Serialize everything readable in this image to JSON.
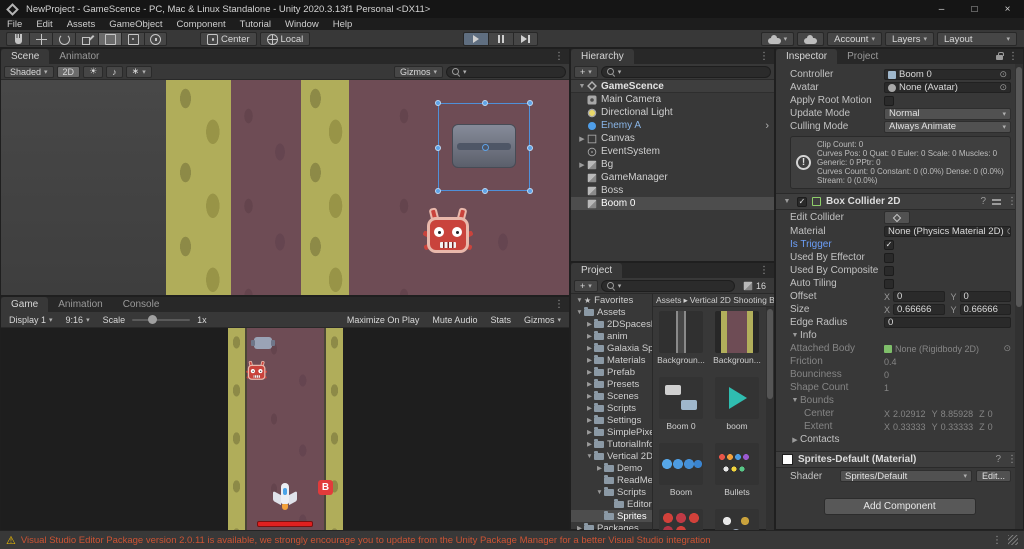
{
  "icons": {
    "caret": "▾",
    "fold_open": "▼",
    "fold_closed": "▶",
    "menu": "⋮",
    "star": "★",
    "warning": "⚠",
    "check": "✓",
    "chevron": "›",
    "crumb_sep": "▸",
    "picker": "⊙",
    "note": "♪",
    "sun": "☀",
    "fx": "∗",
    "plus": "+",
    "question": "?"
  },
  "titlebar": {
    "title": "NewProject - GameScence - PC, Mac & Linux Standalone - Unity 2020.3.13f1 Personal <DX11>",
    "minimize": "–",
    "maximize": "□",
    "close": "×"
  },
  "menubar": {
    "items": [
      "File",
      "Edit",
      "Assets",
      "GameObject",
      "Component",
      "Tutorial",
      "Window",
      "Help"
    ]
  },
  "toolbar": {
    "center": "Center",
    "local": "Local",
    "account": "Account",
    "layers": "Layers",
    "layout": "Layout"
  },
  "scene": {
    "tab_scene": "Scene",
    "tab_animator": "Animator",
    "shaded": "Shaded",
    "mode_2d": "2D",
    "gizmos": "Gizmos"
  },
  "game": {
    "tab_game": "Game",
    "tab_animation": "Animation",
    "tab_console": "Console",
    "display": "Display 1",
    "aspect": "9:16",
    "scale_label": "Scale",
    "scale_value": "1x",
    "maximize_on_play": "Maximize On Play",
    "mute_audio": "Mute Audio",
    "stats": "Stats",
    "gizmos": "Gizmos",
    "boss_badge": "B"
  },
  "hierarchy": {
    "tab": "Hierarchy",
    "scene_name": "GameScence",
    "items": [
      {
        "label": "Main Camera"
      },
      {
        "label": "Directional Light"
      },
      {
        "label": "Enemy A"
      },
      {
        "label": "Canvas"
      },
      {
        "label": "EventSystem"
      },
      {
        "label": "Bg"
      },
      {
        "label": "GameManager"
      },
      {
        "label": "Boss"
      },
      {
        "label": "Boom 0"
      }
    ]
  },
  "project": {
    "tab": "Project",
    "hidden_count": "16",
    "tree": [
      {
        "label": "Favorites"
      },
      {
        "label": "Assets"
      },
      {
        "label": "2DSpacesh..."
      },
      {
        "label": "anim"
      },
      {
        "label": "Galaxia Spr..."
      },
      {
        "label": "Materials"
      },
      {
        "label": "Prefab"
      },
      {
        "label": "Presets"
      },
      {
        "label": "Scenes"
      },
      {
        "label": "Scripts"
      },
      {
        "label": "Settings"
      },
      {
        "label": "SimplePixel..."
      },
      {
        "label": "TutorialInfo"
      },
      {
        "label": "Vertical 2D ..."
      },
      {
        "label": "Demo"
      },
      {
        "label": "ReadMe"
      },
      {
        "label": "Scripts"
      },
      {
        "label": "Editor"
      },
      {
        "label": "Sprites"
      },
      {
        "label": "Packages"
      }
    ],
    "breadcrumb": {
      "root": "Assets",
      "current": "Vertical 2D Shooting B..."
    },
    "assets": [
      {
        "name": "Backgroun..."
      },
      {
        "name": "Backgroun..."
      },
      {
        "name": "Boom 0"
      },
      {
        "name": "boom"
      },
      {
        "name": "Boom"
      },
      {
        "name": "Bullets"
      }
    ]
  },
  "inspector": {
    "tab_inspector": "Inspector",
    "tab_project": "Project",
    "animator": {
      "controller_label": "Controller",
      "controller_value": "Boom 0",
      "avatar_label": "Avatar",
      "avatar_value": "None (Avatar)",
      "apply_root_motion_label": "Apply Root Motion",
      "update_mode_label": "Update Mode",
      "update_mode_value": "Normal",
      "culling_mode_label": "Culling Mode",
      "culling_mode_value": "Always Animate",
      "info_line_1": "Clip Count: 0",
      "info_line_2": "Curves Pos: 0 Quat: 0 Euler: 0 Scale: 0 Muscles: 0",
      "info_line_3": "Generic: 0 PPtr: 0",
      "info_line_4": "Curves Count: 0 Constant: 0 (0.0%) Dense: 0 (0.0%)",
      "info_line_5": "Stream: 0 (0.0%)"
    },
    "collider": {
      "title": "Box Collider 2D",
      "edit_collider_label": "Edit Collider",
      "material_label": "Material",
      "material_value": "None (Physics Material 2D)",
      "is_trigger_label": "Is Trigger",
      "used_by_effector_label": "Used By Effector",
      "used_by_composite_label": "Used By Composite",
      "auto_tiling_label": "Auto Tiling",
      "offset_label": "Offset",
      "offset_x": "0",
      "offset_y": "0",
      "size_label": "Size",
      "size_x": "0.66666",
      "size_y": "0.66666",
      "edge_radius_label": "Edge Radius",
      "edge_radius_value": "0",
      "info_label": "Info",
      "attached_body_label": "Attached Body",
      "attached_body_value": "None (Rigidbody 2D)",
      "friction_label": "Friction",
      "friction_value": "0.4",
      "bounciness_label": "Bounciness",
      "bounciness_value": "0",
      "shape_count_label": "Shape Count",
      "shape_count_value": "1",
      "bounds_label": "Bounds",
      "center_label": "Center",
      "center_x": "2.02912",
      "center_y": "8.85928",
      "center_z": "0",
      "extent_label": "Extent",
      "extent_x": "0.33333",
      "extent_y": "0.33333",
      "extent_z": "0",
      "contacts_label": "Contacts",
      "axis_x": "X",
      "axis_y": "Y",
      "axis_z": "Z"
    },
    "material": {
      "title": "Sprites-Default (Material)",
      "shader_label": "Shader",
      "shader_value": "Sprites/Default",
      "edit_button": "Edit..."
    },
    "add_component": "Add Component"
  },
  "statusbar": {
    "message": "Visual Studio Editor Package version 2.0.11 is available, we strongly encourage you to update from the Unity Package Manager for a better Visual Studio integration"
  }
}
